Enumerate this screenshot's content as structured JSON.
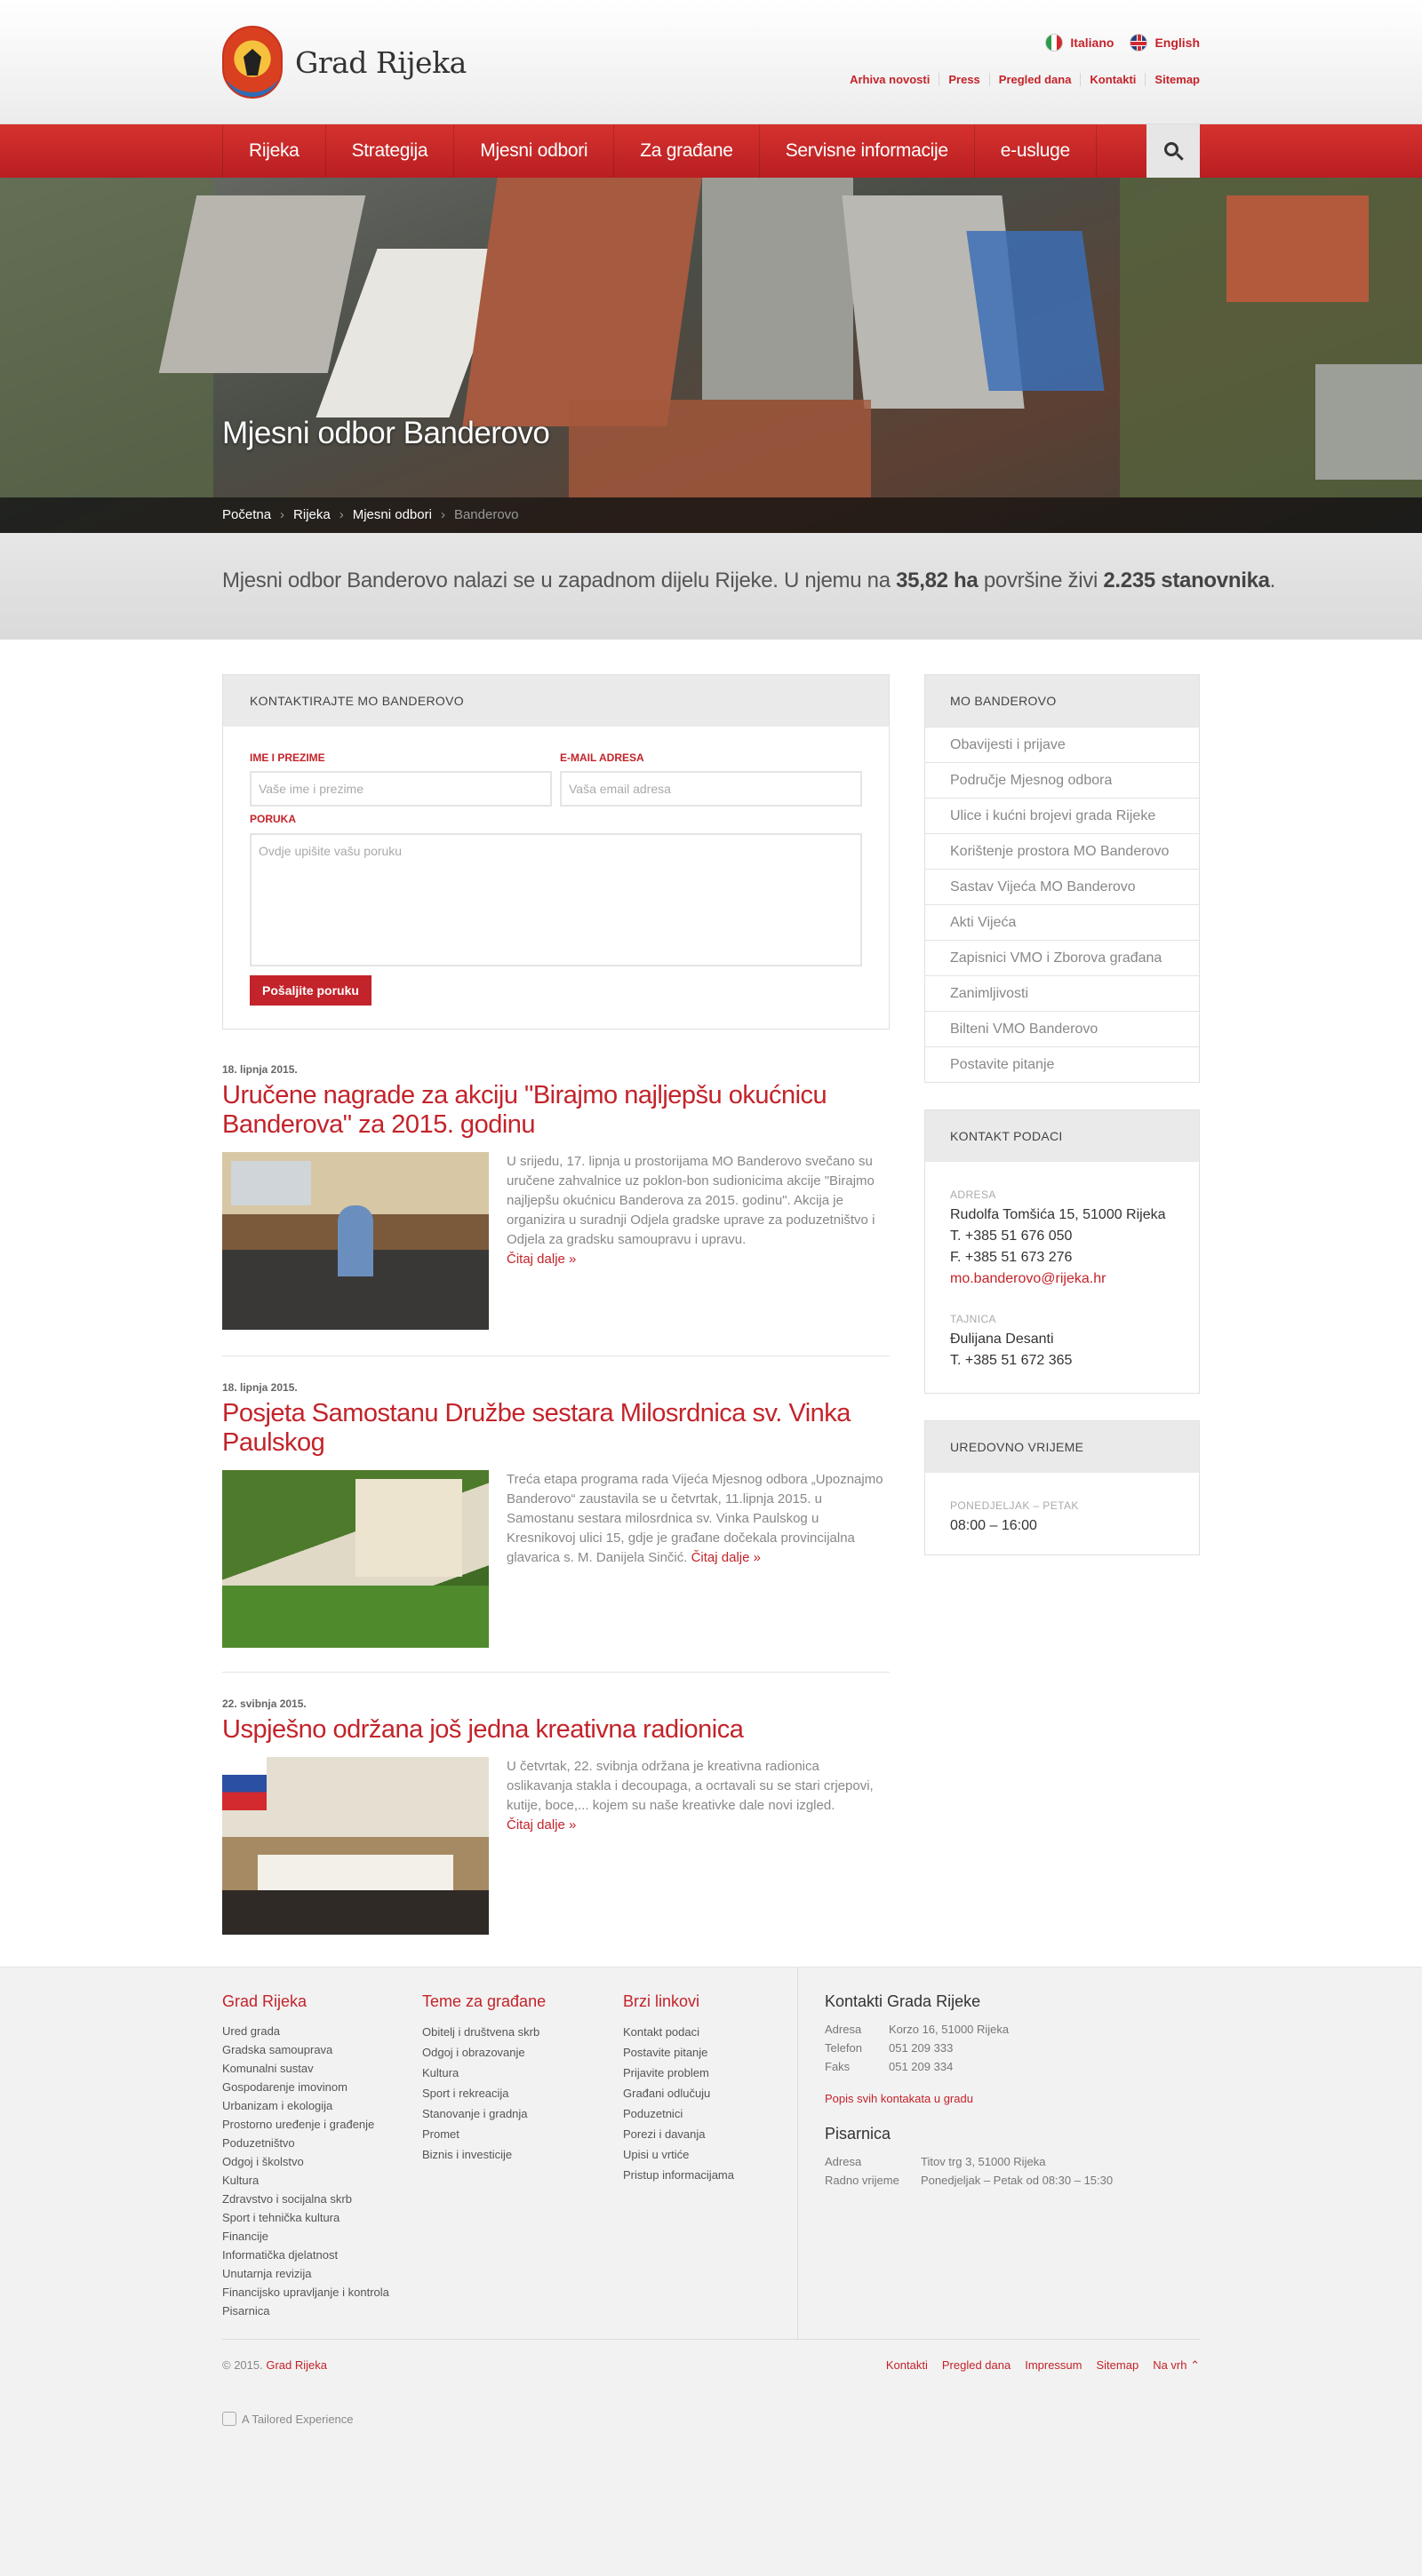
{
  "header": {
    "site_name": "Grad Rijeka",
    "languages": [
      {
        "label": "Italiano",
        "flag": "flag-italy-icon"
      },
      {
        "label": "English",
        "flag": "flag-uk-icon"
      }
    ],
    "utility_links": [
      "Arhiva novosti",
      "Press",
      "Pregled dana",
      "Kontakti",
      "Sitemap"
    ]
  },
  "nav": {
    "items": [
      "Rijeka",
      "Strategija",
      "Mjesni odbori",
      "Za građane",
      "Servisne informacije",
      "e-usluge"
    ],
    "search_icon": "search-icon"
  },
  "hero": {
    "title": "Mjesni odbor Banderovo",
    "breadcrumb": [
      "Početna",
      "Rijeka",
      "Mjesni odbori",
      "Banderovo"
    ]
  },
  "intro": {
    "text_a": "Mjesni odbor Banderovo nalazi se u zapadnom dijelu Rijeke. U njemu na ",
    "area": "35,82 ha",
    "text_b": " površine živi ",
    "population": "2.235 stanovnika",
    "text_c": "."
  },
  "contact_form": {
    "title": "KONTAKTIRAJTE  MO BANDEROVO",
    "name_label": "IME I PREZIME",
    "name_placeholder": "Vaše ime i prezime",
    "email_label": "E-MAIL ADRESA",
    "email_placeholder": "Vaša email adresa",
    "message_label": "PORUKA",
    "message_placeholder": "Ovdje upišite vašu poruku",
    "submit": "Pošaljite poruku"
  },
  "articles": [
    {
      "date": "18. lipnja 2015.",
      "title": "Uručene nagrade za akciju \"Birajmo najljepšu okućnicu Banderova\" za 2015. godinu",
      "text": "U srijedu, 17. lipnja u prostorijama MO Banderovo svečano su uručene zahvalnice uz poklon-bon sudionicima akcije \"Birajmo najljepšu okućnicu Banderova za 2015. godinu\". Akcija je organizira u suradnji Odjela gradske uprave za poduzetništvo i Odjela za gradsku samoupravu i upravu.",
      "more": "Čitaj dalje »"
    },
    {
      "date": "18. lipnja 2015.",
      "title": "Posjeta Samostanu Družbe sestara Milosrdnica sv. Vinka Paulskog",
      "text": "Treća etapa programa rada Vijeća Mjesnog odbora „Upoznajmo Banderovo“ zaustavila se u četvrtak, 11.lipnja 2015. u Samostanu sestara milosrdnica sv. Vinka Paulskog u Kresnikovoj ulici 15, gdje je građane dočekala provincijalna glavarica s. M. Danijela Sinčić.",
      "more": "Čitaj dalje »"
    },
    {
      "date": "22. svibnja 2015.",
      "title": "Uspješno održana još jedna kreativna radionica",
      "text": "U četvrtak, 22. svibnja održana je kreativna radionica oslikavanja stakla i decoupaga, a ocrtavali su se stari crjepovi, kutije, boce,... kojem su naše kreativke dale novi izgled.",
      "more": "Čitaj dalje »"
    }
  ],
  "sidebar": {
    "menu_title": "MO BANDEROVO",
    "menu_items": [
      "Obavijesti i prijave",
      "Područje Mjesnog odbora",
      "Ulice i kućni brojevi grada Rijeke",
      "Korištenje prostora MO Banderovo",
      "Sastav Vijeća MO Banderovo",
      "Akti Vijeća",
      "Zapisnici VMO i Zborova građana",
      "Zanimljivosti",
      "Bilteni VMO Banderovo",
      "Postavite pitanje"
    ],
    "contact_title": "KONTAKT PODACI",
    "address_label": "ADRESA",
    "address": "Rudolfa Tomšića 15, 51000 Rijeka",
    "phone": "T. +385 51 676 050",
    "fax": "F. +385 51 673 276",
    "email": "mo.banderovo@rijeka.hr",
    "secretary_label": "TAJNICA",
    "secretary_name": "Đulijana Desanti",
    "secretary_phone": "T. +385 51 672 365",
    "hours_title": "UREDOVNO VRIJEME",
    "hours_label": "PONEDJELJAK – PETAK",
    "hours": "08:00 – 16:00"
  },
  "footer": {
    "col1_title": "Grad Rijeka",
    "col1_links": [
      "Ured grada",
      "Gradska samouprava",
      "Komunalni sustav",
      "Gospodarenje imovinom",
      "Urbanizam i ekologija",
      "Prostorno uređenje i građenje",
      "Poduzetništvo",
      "Odgoj i školstvo",
      "Kultura",
      "Zdravstvo i socijalna skrb",
      "Sport i tehnička kultura",
      "Financije",
      "Informatička djelatnost",
      "Unutarnja revizija",
      "Financijsko upravljanje i kontrola",
      "Pisarnica"
    ],
    "col2_title": "Teme za građane",
    "col2_links": [
      "Obitelj i društvena skrb",
      "Odgoj i obrazovanje",
      "Kultura",
      "Sport i rekreacija",
      "Stanovanje i gradnja",
      "Promet",
      "Biznis i investicije"
    ],
    "col3_title": "Brzi linkovi",
    "col3_links": [
      "Kontakt podaci",
      "Postavite pitanje",
      "Prijavite problem",
      "Građani odlučuju",
      "Poduzetnici",
      "Porezi i davanja",
      "Upisi u vrtiće",
      "Pristup informacijama"
    ],
    "contacts_title": "Kontakti Grada Rijeke",
    "contacts": [
      {
        "label": "Adresa",
        "value": "Korzo 16, 51000 Rijeka"
      },
      {
        "label": "Telefon",
        "value": "051 209 333"
      },
      {
        "label": "Faks",
        "value": "051 209 334"
      }
    ],
    "all_contacts": "Popis svih kontakata u gradu",
    "pisarnica_title": "Pisarnica",
    "pisarnica": [
      {
        "label": "Adresa",
        "value": "Titov trg 3, 51000 Rijeka"
      },
      {
        "label": "Radno vrijeme",
        "value": "Ponedjeljak – Petak od 08:30 – 15:30"
      }
    ],
    "copyright": "© 2015.",
    "copyright_link": "Grad Rijeka",
    "bottom_links": [
      "Kontakti",
      "Pregled dana",
      "Impressum",
      "Sitemap",
      "Na vrh ⌃"
    ],
    "credit": "A Tailored Experience"
  },
  "colors": {
    "accent": "#c3232a",
    "nav": "#c8292b"
  }
}
